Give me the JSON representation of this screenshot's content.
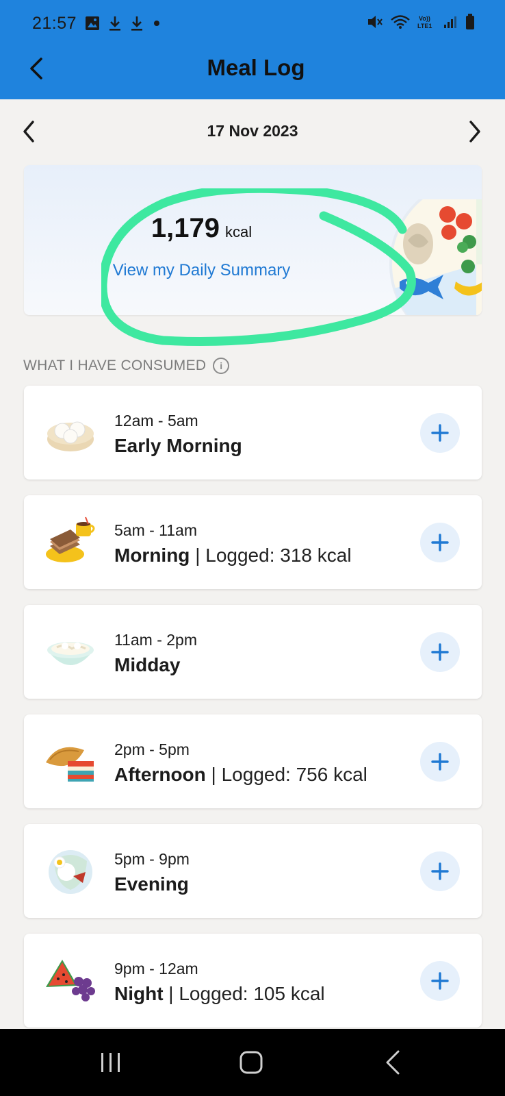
{
  "status_bar": {
    "time": "21:57",
    "left_icons": [
      "image-icon",
      "download-icon",
      "download-icon",
      "dot-icon"
    ],
    "right_icons": [
      "mute-icon",
      "wifi-icon",
      "volte-icon",
      "signal-icon",
      "battery-icon"
    ],
    "network_label": "Vo))\nLTE1"
  },
  "app_bar": {
    "title": "Meal Log",
    "back_icon": "chevron-left-icon"
  },
  "date_nav": {
    "date": "17 Nov 2023",
    "prev_icon": "chevron-left-icon",
    "next_icon": "chevron-right-icon"
  },
  "summary": {
    "kcal_value": "1,179",
    "kcal_unit": "kcal",
    "link_text": "View my Daily Summary"
  },
  "section": {
    "title": "WHAT I HAVE CONSUMED",
    "info_icon": "i"
  },
  "meals": [
    {
      "time": "12am - 5am",
      "name": "Early Morning",
      "logged": "",
      "icon": "dim-sum-icon"
    },
    {
      "time": "5am - 11am",
      "name": "Morning",
      "logged": " | Logged: 318 kcal",
      "icon": "kaya-toast-coffee-icon"
    },
    {
      "time": "11am - 2pm",
      "name": "Midday",
      "logged": "",
      "icon": "noodle-bowl-icon"
    },
    {
      "time": "2pm - 5pm",
      "name": "Afternoon",
      "logged": " | Logged: 756 kcal",
      "icon": "curry-puff-kueh-icon"
    },
    {
      "time": "5pm - 9pm",
      "name": "Evening",
      "logged": "",
      "icon": "nasi-lemak-icon"
    },
    {
      "time": "9pm - 12am",
      "name": "Night",
      "logged": " | Logged: 105 kcal",
      "icon": "watermelon-grapes-icon"
    }
  ],
  "colors": {
    "app_bar": "#1f83dd",
    "accent_link": "#1f79d3",
    "annotation": "#3ee8a0",
    "background": "#f3f2f0"
  },
  "nav_bar": {
    "buttons": [
      "recents-icon",
      "home-icon",
      "back-icon"
    ]
  }
}
